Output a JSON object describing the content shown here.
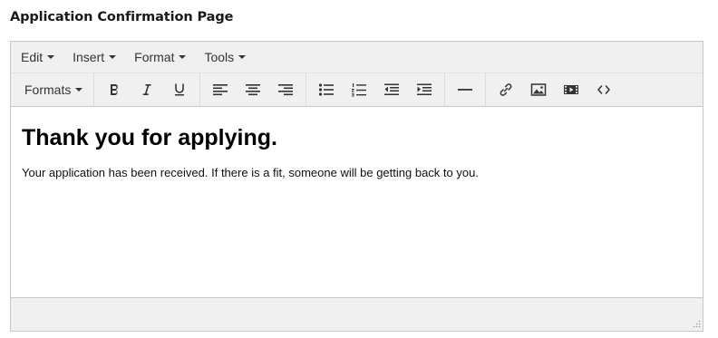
{
  "page": {
    "title": "Application Confirmation Page"
  },
  "menubar": {
    "items": [
      {
        "label": "Edit",
        "icon": "caret-down-icon"
      },
      {
        "label": "Insert",
        "icon": "caret-down-icon"
      },
      {
        "label": "Format",
        "icon": "caret-down-icon"
      },
      {
        "label": "Tools",
        "icon": "caret-down-icon"
      }
    ]
  },
  "toolbar": {
    "formats_label": "Formats",
    "buttons": [
      "bold-icon",
      "italic-icon",
      "underline-icon",
      "align-left-icon",
      "align-center-icon",
      "align-right-icon",
      "bullet-list-icon",
      "numbered-list-icon",
      "outdent-icon",
      "indent-icon",
      "horizontal-rule-icon",
      "link-icon",
      "image-icon",
      "media-icon",
      "code-icon"
    ]
  },
  "content": {
    "heading": "Thank you for applying.",
    "body": "Your application has been received. If there is a fit, someone will be getting back to you."
  },
  "colors": {
    "toolbar_bg": "#f0f0f0",
    "border": "#c7c7c7",
    "icon": "#333333"
  }
}
